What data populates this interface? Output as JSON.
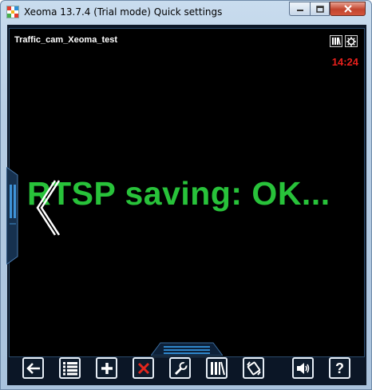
{
  "window": {
    "title": "Xeoma 13.7.4 (Trial mode) Quick settings",
    "minimize_icon": "minimize-icon",
    "maximize_icon": "maximize-icon",
    "close_icon": "close-icon"
  },
  "camera": {
    "name": "Traffic_cam_Xeoma_test",
    "time": "14:24",
    "overlay": "RTSP saving: OK...",
    "overlay_color": "#28c23a",
    "time_color": "#e8201c"
  },
  "toolbar": {
    "buttons": [
      {
        "icon": "back-arrow-icon"
      },
      {
        "icon": "list-icon"
      },
      {
        "icon": "add-icon"
      },
      {
        "icon": "delete-icon"
      },
      {
        "icon": "wrench-icon"
      },
      {
        "icon": "archive-icon"
      },
      {
        "icon": "ptz-icon"
      },
      {
        "icon": "sound-icon"
      },
      {
        "icon": "help-icon"
      }
    ],
    "help_label": "?"
  }
}
